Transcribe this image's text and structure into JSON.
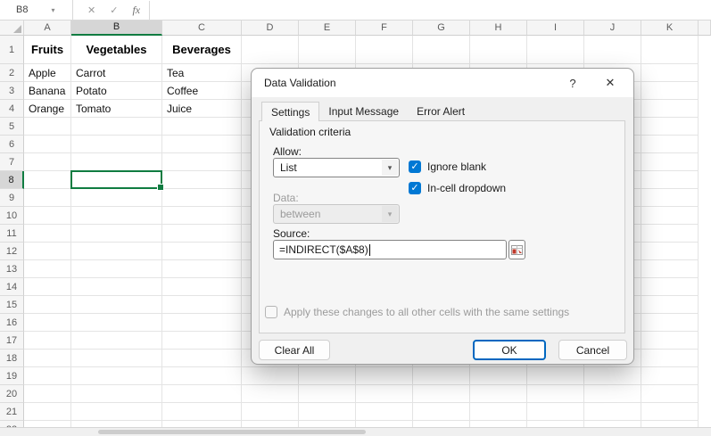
{
  "topbar": {
    "name_box": "B8",
    "cancel_glyph": "✕",
    "enter_glyph": "✓",
    "fx_glyph": "fx"
  },
  "sheet": {
    "columns": [
      "A",
      "B",
      "C",
      "D",
      "E",
      "F",
      "G",
      "H",
      "I",
      "J",
      "K"
    ],
    "row_count": 22,
    "selected_cell": "B8",
    "cells": [
      {
        "ref": "A1",
        "text": "Fruits",
        "bold": true
      },
      {
        "ref": "B1",
        "text": "Vegetables",
        "bold": true
      },
      {
        "ref": "C1",
        "text": "Beverages",
        "bold": true
      },
      {
        "ref": "A2",
        "text": "Apple"
      },
      {
        "ref": "B2",
        "text": "Carrot"
      },
      {
        "ref": "C2",
        "text": "Tea"
      },
      {
        "ref": "A3",
        "text": "Banana"
      },
      {
        "ref": "B3",
        "text": "Potato"
      },
      {
        "ref": "C3",
        "text": "Coffee"
      },
      {
        "ref": "A4",
        "text": "Orange"
      },
      {
        "ref": "B4",
        "text": "Tomato"
      },
      {
        "ref": "C4",
        "text": "Juice"
      }
    ]
  },
  "dialog": {
    "title": "Data Validation",
    "help_glyph": "?",
    "close_glyph": "✕",
    "tabs": [
      {
        "label": "Settings"
      },
      {
        "label": "Input Message"
      },
      {
        "label": "Error Alert"
      }
    ],
    "active_tab": "Settings",
    "validation_criteria": "Validation criteria",
    "allow_label": "Allow:",
    "allow_value": "List",
    "checkbox_ignore_blank": "Ignore blank",
    "checkbox_in_cell_dropdown": "In-cell dropdown",
    "data_label": "Data:",
    "data_value": "between",
    "source_label": "Source:",
    "source_value": "=INDIRECT($A$8)",
    "apply_label": "Apply these changes to all other cells with the same settings",
    "clear_all": "Clear All",
    "ok": "OK",
    "cancel": "Cancel",
    "check_glyph": "✓",
    "arrow_glyph": "▾"
  },
  "colors": {
    "selection_green": "#107C41",
    "checkbox_blue": "#0078D4",
    "ok_border_blue": "#0067C0"
  }
}
